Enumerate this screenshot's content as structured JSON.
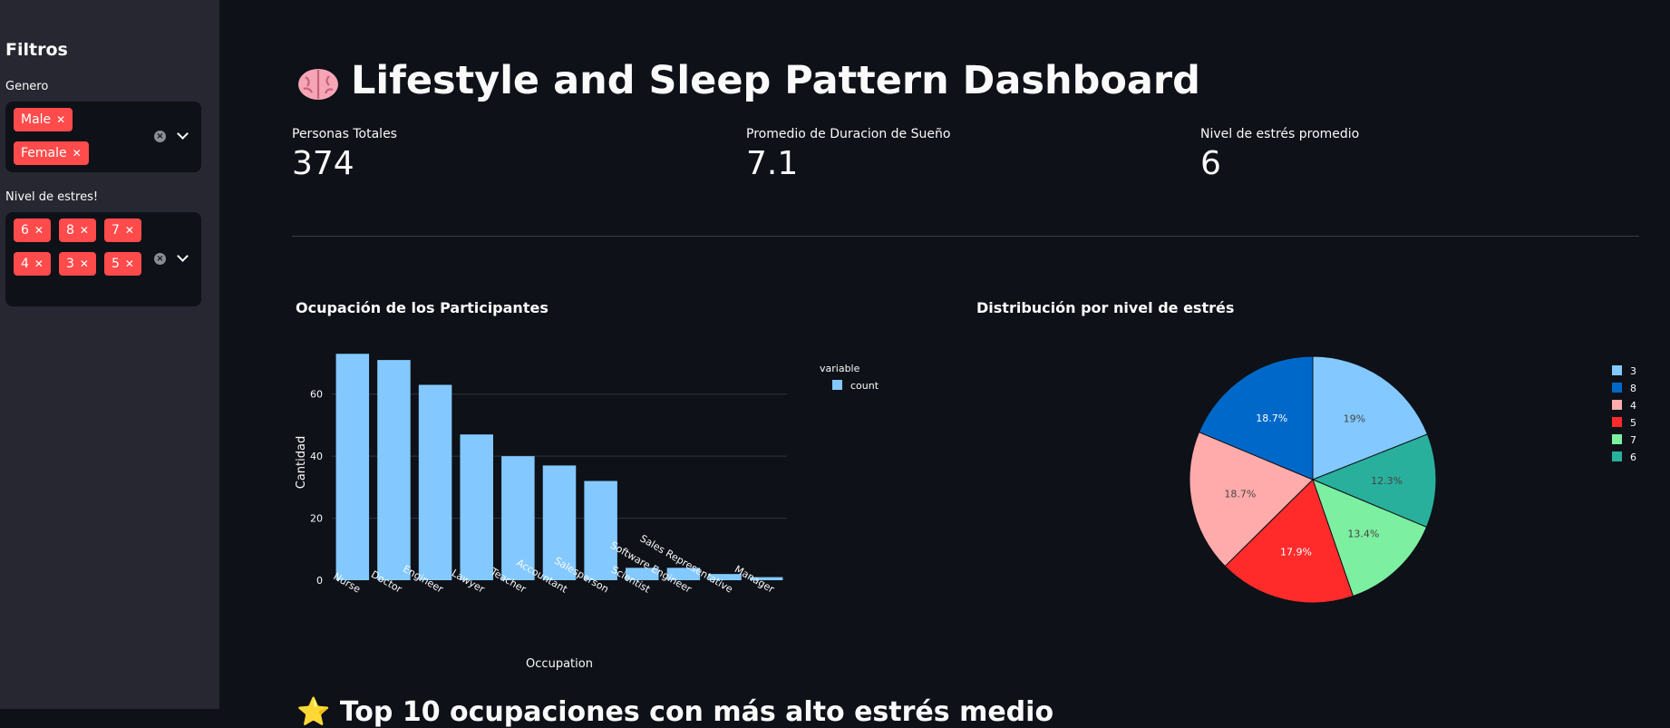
{
  "sidebar": {
    "title": "Filtros",
    "genero": {
      "label": "Genero",
      "tags": [
        "Male",
        "Female"
      ]
    },
    "estres": {
      "label": "Nivel de estres!",
      "tags": [
        "6",
        "8",
        "7",
        "4",
        "3",
        "5"
      ]
    }
  },
  "main": {
    "title": "Lifestyle and Sleep Pattern Dashboard",
    "metrics": [
      {
        "label": "Personas Totales",
        "value": "374"
      },
      {
        "label": "Promedio de Duracion de Sueño",
        "value": "7.1"
      },
      {
        "label": "Nivel de estrés promedio",
        "value": "6"
      }
    ],
    "bottom_heading": "Top 10 ocupaciones con más alto estrés medio"
  },
  "chart_data": [
    {
      "type": "bar",
      "title": "Ocupación de los Participantes",
      "xlabel": "Occupation",
      "ylabel": "Cantidad",
      "legend_title": "variable",
      "categories": [
        "Nurse",
        "Doctor",
        "Engineer",
        "Lawyer",
        "Teacher",
        "Accountant",
        "Salesperson",
        "Scientist",
        "Software Engineer",
        "Sales Representative",
        "Manager"
      ],
      "series": [
        {
          "name": "count",
          "values": [
            73,
            71,
            63,
            47,
            40,
            37,
            32,
            4,
            4,
            2,
            1
          ]
        }
      ],
      "yticks": [
        0,
        20,
        40,
        60
      ],
      "ylim": [
        0,
        76
      ],
      "color": "#83c9ff",
      "legend_position": "top-right"
    },
    {
      "type": "pie",
      "title": "Distribución por nivel de estrés",
      "labels": [
        "3",
        "8",
        "4",
        "5",
        "7",
        "6"
      ],
      "values": [
        19,
        18.7,
        18.7,
        17.9,
        13.4,
        12.3
      ],
      "value_labels": [
        "19%",
        "18.7%",
        "18.7%",
        "17.9%",
        "13.4%",
        "12.3%"
      ],
      "slice_order": [
        "3",
        "6",
        "7",
        "5",
        "4",
        "8"
      ],
      "colors": {
        "3": "#83c9ff",
        "8": "#0068c9",
        "4": "#ffabab",
        "5": "#ff2b2b",
        "7": "#7defa1",
        "6": "#29b09d"
      },
      "label_colors": {
        "3": "#444444",
        "8": "#ffffff",
        "4": "#444444",
        "5": "#ffffff",
        "7": "#444444",
        "6": "#444444"
      },
      "legend_position": "top-right"
    }
  ]
}
